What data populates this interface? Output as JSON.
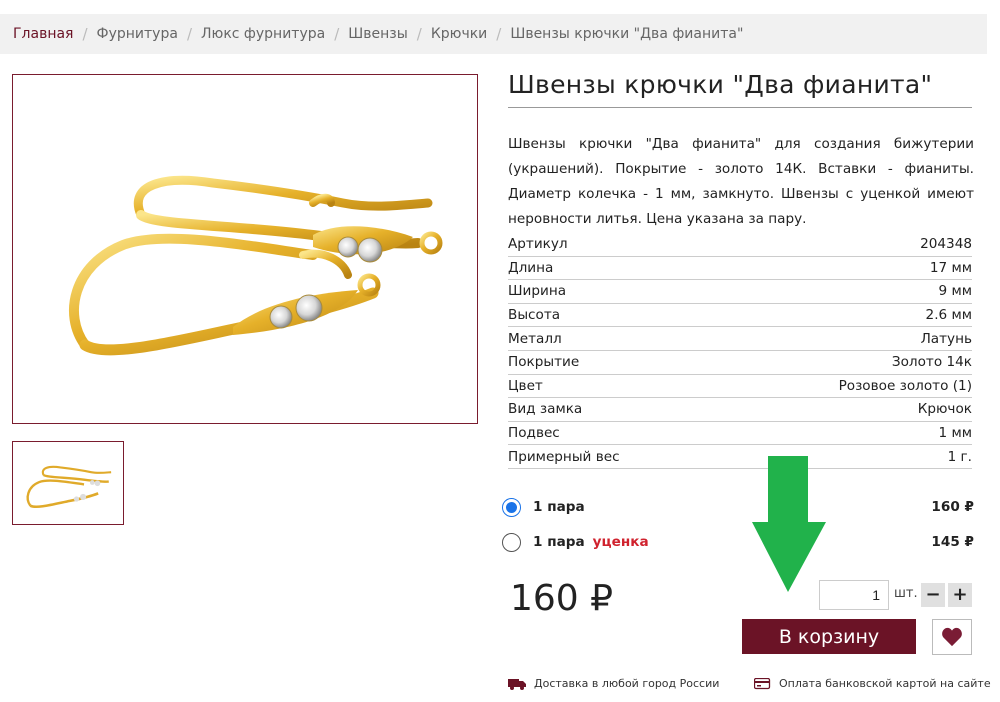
{
  "breadcrumb": [
    "Главная",
    "Фурнитура",
    "Люкс фурнитура",
    "Швензы",
    "Крючки",
    "Швензы крючки \"Два фианита\""
  ],
  "product": {
    "title": "Швензы крючки \"Два фианита\"",
    "description": "Швензы крючки \"Два фианита\" для создания бижутерии (украшений). Покрытие - золото 14К. Вставки - фианиты. Диаметр колечка - 1 мм, замкнуто. Швензы с уценкой имеют неровности литья. Цена указана за пару."
  },
  "specs": [
    {
      "label": "Артикул",
      "value": "204348"
    },
    {
      "label": "Длина",
      "value": "17 мм"
    },
    {
      "label": "Ширина",
      "value": "9 мм"
    },
    {
      "label": "Высота",
      "value": "2.6 мм"
    },
    {
      "label": "Металл",
      "value": "Латунь"
    },
    {
      "label": "Покрытие",
      "value": "Золото 14к"
    },
    {
      "label": "Цвет",
      "value": "Розовое золото (1)"
    },
    {
      "label": "Вид замка",
      "value": "Крючок"
    },
    {
      "label": "Подвес",
      "value": "1 мм"
    },
    {
      "label": "Примерный вес",
      "value": "1 г."
    }
  ],
  "options": [
    {
      "label": "1 пара",
      "discount": "",
      "price": "160 ₽",
      "selected": true
    },
    {
      "label": "1 пара",
      "discount": "уценка",
      "price": "145 ₽",
      "selected": false
    }
  ],
  "price_display": "160 ₽",
  "quantity": {
    "value": "1",
    "unit": "шт.",
    "minus": "−",
    "plus": "+"
  },
  "cart_button": "В корзину",
  "info": {
    "delivery": "Доставка в любой город России",
    "payment": "Оплата банковской картой на сайте"
  },
  "colors": {
    "brand": "#6b1326",
    "arrow": "#21b24b",
    "discount": "#d0222e",
    "radio": "#1a73e8"
  }
}
